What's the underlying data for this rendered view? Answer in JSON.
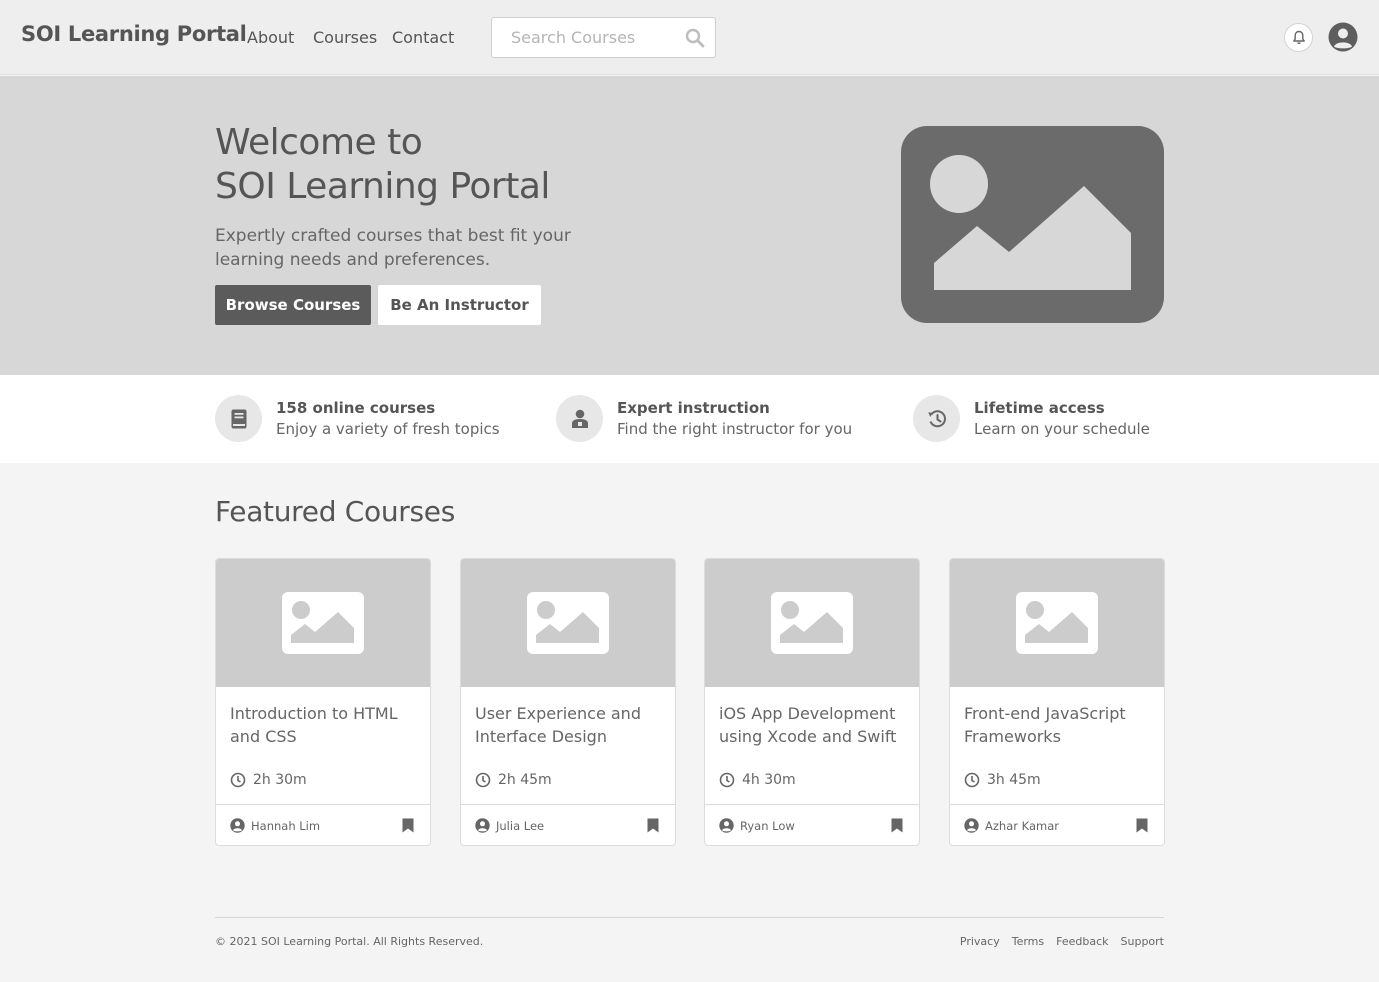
{
  "nav": {
    "brand": "SOI Learning Portal",
    "links": [
      "About",
      "Courses",
      "Contact"
    ],
    "search_placeholder": "Search Courses"
  },
  "hero": {
    "title_line1": "Welcome to",
    "title_line2": "SOI Learning Portal",
    "subtitle": "Expertly crafted courses that best fit your learning needs and preferences.",
    "primary_button": "Browse Courses",
    "secondary_button": "Be An Instructor"
  },
  "features": [
    {
      "icon": "book-icon",
      "title": "158 online courses",
      "desc": "Enjoy a variety of fresh topics"
    },
    {
      "icon": "instructor-icon",
      "title": "Expert instruction",
      "desc": "Find the right instructor for you"
    },
    {
      "icon": "history-icon",
      "title": "Lifetime access",
      "desc": "Learn on your schedule"
    }
  ],
  "featured": {
    "heading": "Featured Courses",
    "courses": [
      {
        "title": "Introduction to HTML and CSS",
        "duration": "2h 30m",
        "author": "Hannah Lim"
      },
      {
        "title": "User Experience and Interface Design",
        "duration": "2h 45m",
        "author": "Julia Lee"
      },
      {
        "title": "iOS App Development using Xcode and Swift",
        "duration": "4h 30m",
        "author": "Ryan Low"
      },
      {
        "title": "Front-end JavaScript Frameworks",
        "duration": "3h 45m",
        "author": "Azhar Kamar"
      }
    ]
  },
  "footer": {
    "copyright": "© 2021 SOI Learning Portal. All Rights Reserved.",
    "links": [
      "Privacy",
      "Terms",
      "Feedback",
      "Support"
    ]
  },
  "colors": {
    "hero_bg": "#d7d7d7",
    "dark_button": "#5b5b5b",
    "placeholder_dark": "#6b6b6b",
    "thumb_bg": "#cccccc"
  }
}
